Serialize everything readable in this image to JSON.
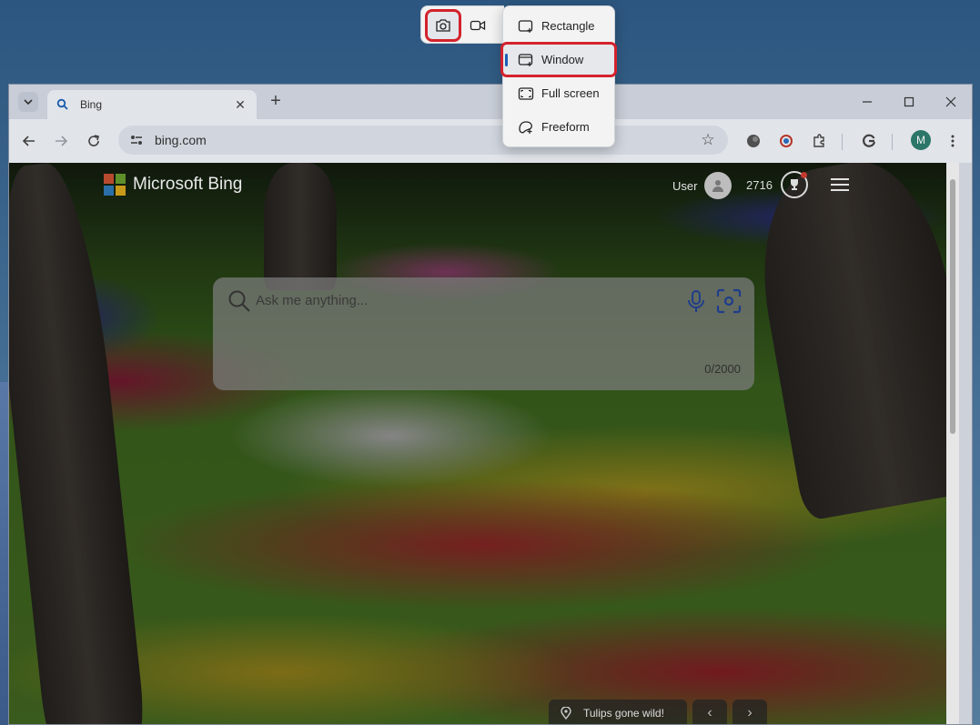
{
  "browser": {
    "tab_title": "Bing",
    "address": "bing.com"
  },
  "bing": {
    "logo_text": "Microsoft Bing",
    "user_label": "User",
    "points": "2716",
    "search_placeholder": "Ask me anything...",
    "char_count": "0/2000",
    "image_caption": "Tulips gone wild!"
  },
  "snip_menu": {
    "items": [
      {
        "label": "Rectangle",
        "icon": "rectangle-snip-icon"
      },
      {
        "label": "Window",
        "icon": "window-snip-icon"
      },
      {
        "label": "Full screen",
        "icon": "fullscreen-snip-icon"
      },
      {
        "label": "Freeform",
        "icon": "freeform-snip-icon"
      }
    ],
    "selected": "Window"
  },
  "colors": {
    "highlight": "#d3222c",
    "selected_indicator": "#1a5fb4",
    "profile": "#2e7d6f"
  },
  "profile_initial": "M"
}
